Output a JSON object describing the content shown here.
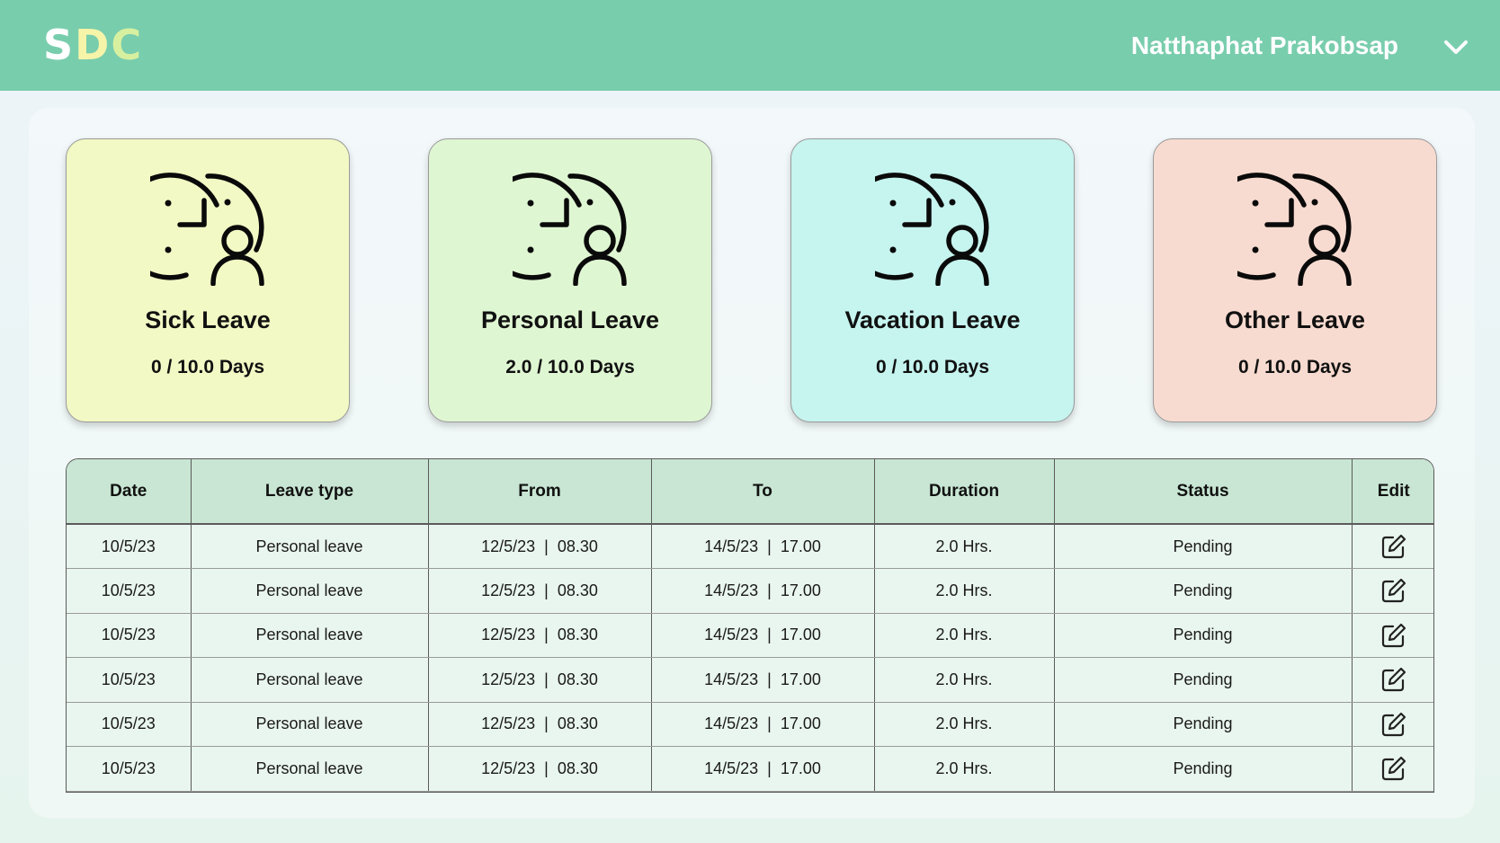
{
  "header": {
    "logo_letters": [
      "S",
      "D",
      "C"
    ],
    "logo_colors": [
      "#ffffff",
      "#f6f4a8",
      "#d7f0a0"
    ],
    "user_name": "Natthaphat Prakobsap",
    "bar_color": "#78cdad"
  },
  "cards": [
    {
      "title": "Sick Leave",
      "days": "0 / 10.0 Days",
      "bg": "#f2f9c4",
      "icon": "clock-user-icon"
    },
    {
      "title": "Personal Leave",
      "days": "2.0 / 10.0 Days",
      "bg": "#dff6d2",
      "icon": "clock-user-icon"
    },
    {
      "title": "Vacation Leave",
      "days": "0 / 10.0 Days",
      "bg": "#c6f4ef",
      "icon": "clock-user-icon"
    },
    {
      "title": "Other Leave",
      "days": "0 / 10.0 Days",
      "bg": "#f8dbd0",
      "icon": "clock-user-icon"
    }
  ],
  "table": {
    "headers": [
      "Date",
      "Leave type",
      "From",
      "To",
      "Duration",
      "Status",
      "Edit"
    ],
    "rows": [
      [
        "10/5/23",
        "Personal leave",
        "12/5/23  |  08.30",
        "14/5/23  |  17.00",
        "2.0 Hrs.",
        "Pending"
      ],
      [
        "10/5/23",
        "Personal leave",
        "12/5/23  |  08.30",
        "14/5/23  |  17.00",
        "2.0 Hrs.",
        "Pending"
      ],
      [
        "10/5/23",
        "Personal leave",
        "12/5/23  |  08.30",
        "14/5/23  |  17.00",
        "2.0 Hrs.",
        "Pending"
      ],
      [
        "10/5/23",
        "Personal leave",
        "12/5/23  |  08.30",
        "14/5/23  |  17.00",
        "2.0 Hrs.",
        "Pending"
      ],
      [
        "10/5/23",
        "Personal leave",
        "12/5/23  |  08.30",
        "14/5/23  |  17.00",
        "2.0 Hrs.",
        "Pending"
      ],
      [
        "10/5/23",
        "Personal leave",
        "12/5/23  |  08.30",
        "14/5/23  |  17.00",
        "2.0 Hrs.",
        "Pending"
      ]
    ],
    "edit_icon": "edit-icon"
  }
}
